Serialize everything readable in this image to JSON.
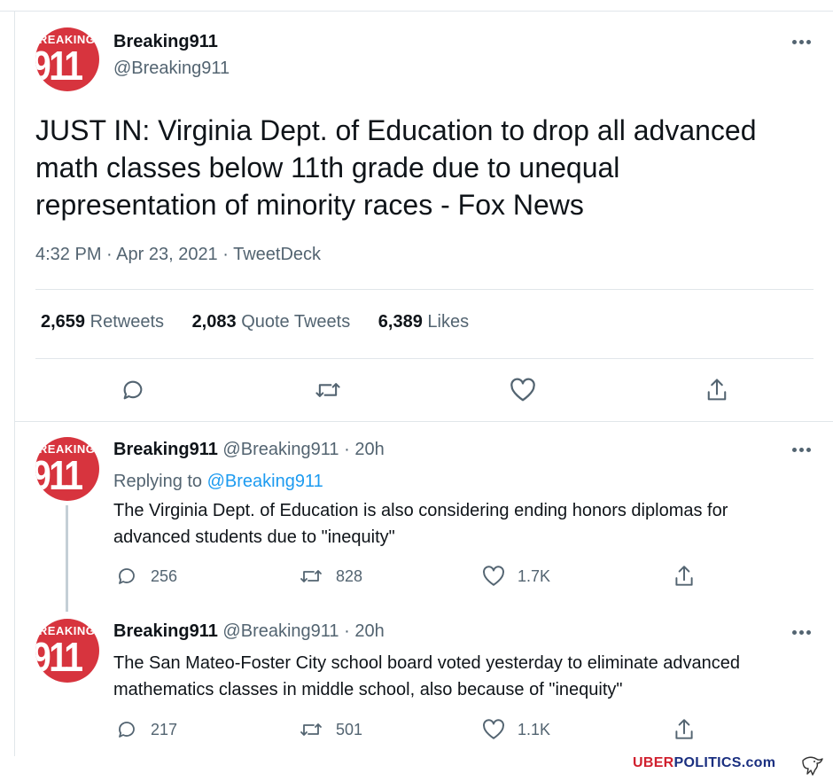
{
  "main_tweet": {
    "avatar": {
      "top_text": "BREAKING",
      "number": "911"
    },
    "display_name": "Breaking911",
    "handle": "@Breaking911",
    "text": "JUST IN: Virginia Dept. of Education to drop all advanced math classes below 11th grade due to unequal representation of minority races - Fox News",
    "meta": "4:32 PM · Apr 23, 2021 · TweetDeck",
    "stats": {
      "retweets_count": "2,659",
      "retweets_label": "Retweets",
      "quotes_count": "2,083",
      "quotes_label": "Quote Tweets",
      "likes_count": "6,389",
      "likes_label": "Likes"
    },
    "actions": [
      "reply-icon",
      "retweet-icon",
      "like-icon",
      "share-icon"
    ]
  },
  "replies": [
    {
      "display_name": "Breaking911",
      "handle": "@Breaking911",
      "time": "· 20h",
      "replying_prefix": "Replying to",
      "replying_handle": "@Breaking911",
      "text": "The Virginia Dept. of Education is also considering ending honors diplomas for advanced students due to \"inequity\"",
      "replies": "256",
      "retweets": "828",
      "likes": "1.7K"
    },
    {
      "display_name": "Breaking911",
      "handle": "@Breaking911",
      "time": "· 20h",
      "text": "The San Mateo-Foster City school board voted yesterday to eliminate advanced mathematics classes in middle school, also because of \"inequity\"",
      "replies": "217",
      "retweets": "501",
      "likes": "1.1K"
    }
  ],
  "watermark": {
    "part1": "UBER",
    "part2": "POLITICS.com"
  },
  "colors": {
    "text": "#0f1419",
    "muted": "#536471",
    "link": "#1d9bf0",
    "avatar": "#d7343e",
    "border": "#e1e6ea"
  }
}
